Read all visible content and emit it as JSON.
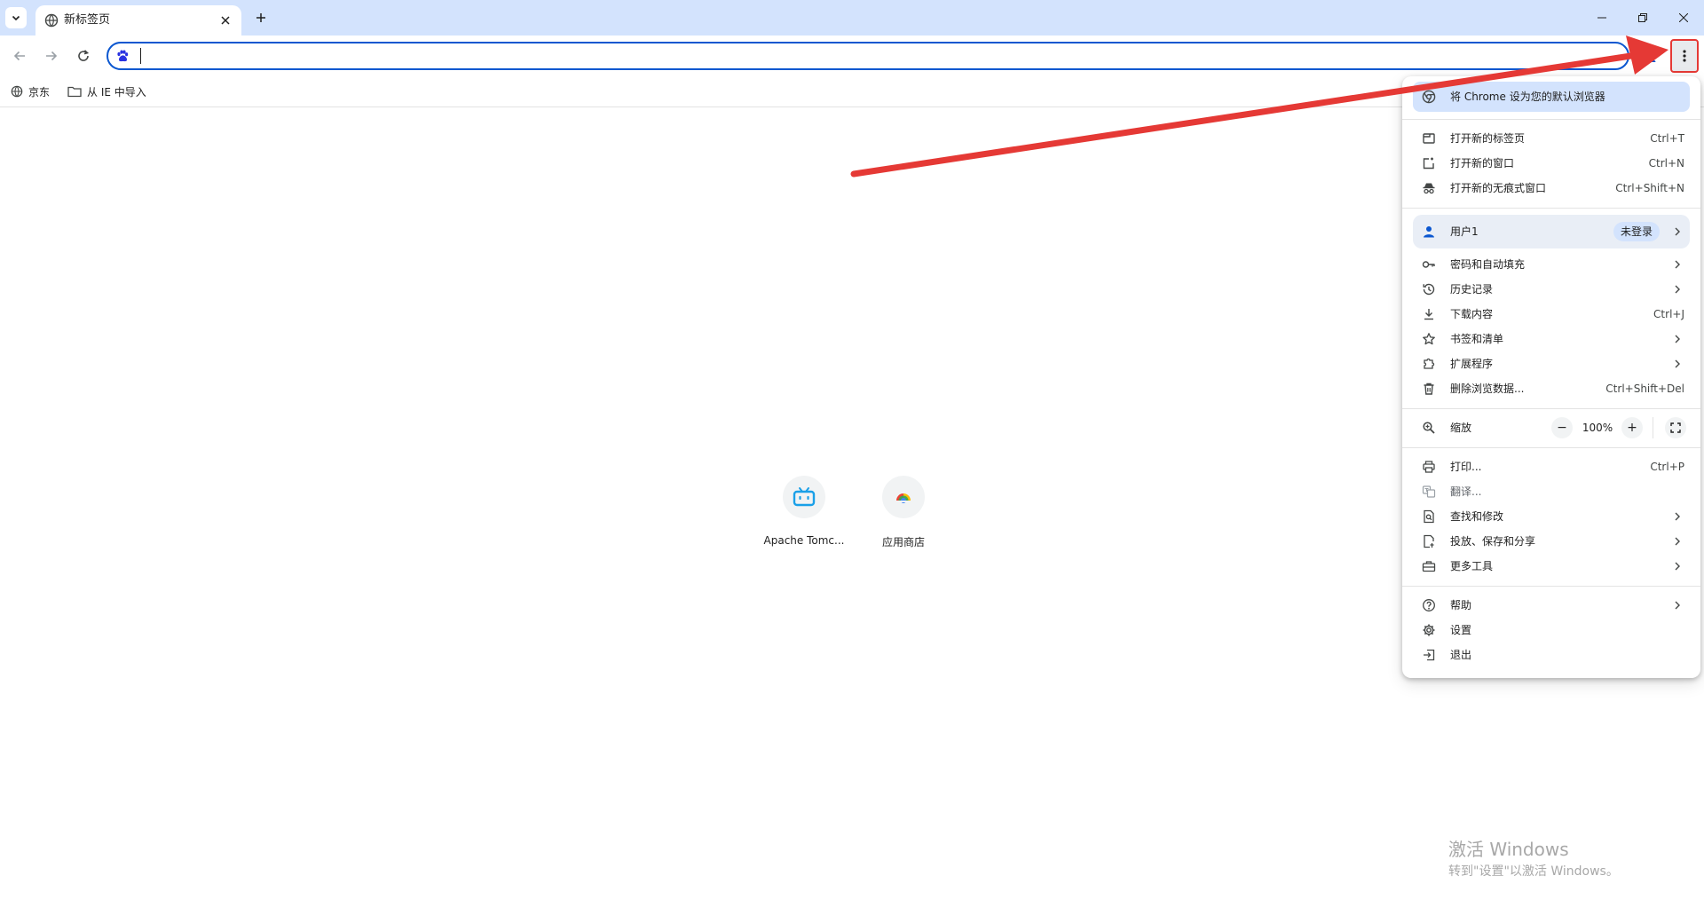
{
  "tab": {
    "title": "新标签页"
  },
  "omnibox": {
    "value": "",
    "placeholder": ""
  },
  "bookmarks": [
    {
      "label": "京东"
    },
    {
      "label": "从 IE 中导入"
    }
  ],
  "shortcuts": [
    {
      "label": "Apache Tomc..."
    },
    {
      "label": "应用商店"
    }
  ],
  "menu": {
    "default_browser": "将 Chrome 设为您的默认浏览器",
    "new_tab": {
      "label": "打开新的标签页",
      "shortcut": "Ctrl+T"
    },
    "new_window": {
      "label": "打开新的窗口",
      "shortcut": "Ctrl+N"
    },
    "incognito": {
      "label": "打开新的无痕式窗口",
      "shortcut": "Ctrl+Shift+N"
    },
    "user": {
      "label": "用户1",
      "badge": "未登录"
    },
    "passwords": {
      "label": "密码和自动填充"
    },
    "history": {
      "label": "历史记录"
    },
    "downloads": {
      "label": "下载内容",
      "shortcut": "Ctrl+J"
    },
    "bookmarks": {
      "label": "书签和清单"
    },
    "extensions": {
      "label": "扩展程序"
    },
    "clear_data": {
      "label": "删除浏览数据...",
      "shortcut": "Ctrl+Shift+Del"
    },
    "zoom": {
      "label": "缩放",
      "value": "100%",
      "minus": "−",
      "plus": "+"
    },
    "print": {
      "label": "打印...",
      "shortcut": "Ctrl+P"
    },
    "translate": {
      "label": "翻译..."
    },
    "find": {
      "label": "查找和修改"
    },
    "cast": {
      "label": "投放、保存和分享"
    },
    "more_tools": {
      "label": "更多工具"
    },
    "help": {
      "label": "帮助"
    },
    "settings": {
      "label": "设置"
    },
    "exit": {
      "label": "退出"
    }
  },
  "watermark": {
    "line1": "激活 Windows",
    "line2": "转到\"设置\"以激活 Windows。"
  },
  "colors": {
    "tabstrip": "#d3e3fd",
    "accent": "#0b57d0",
    "annotation": "#e53935"
  }
}
